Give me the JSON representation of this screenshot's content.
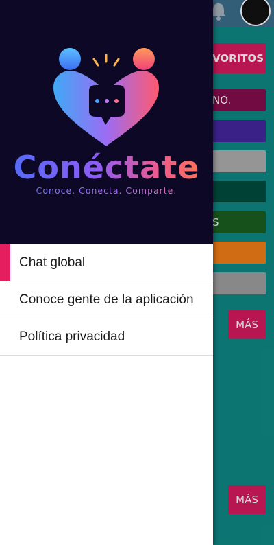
{
  "background": {
    "buttons": [
      {
        "label": "VORITOS",
        "color": "#d81b60"
      },
      {
        "label": "NO.",
        "color": "#880e4f"
      },
      {
        "label": "",
        "color": "#4527a0"
      },
      {
        "label": "",
        "color": "#b0b0b0"
      },
      {
        "label": "",
        "color": "#004d40"
      },
      {
        "label": "S",
        "color": "#1b5e20"
      },
      {
        "label": "",
        "color": "#f57f17"
      },
      {
        "label": "",
        "color": "#a0a0a0"
      }
    ],
    "more_label_1": "MÁS",
    "more_label_2": "MÁS"
  },
  "drawer": {
    "brand": "Conéctate",
    "tagline": "Conoce. Conecta. Comparte.",
    "menu": [
      {
        "label": "Chat global",
        "active": true
      },
      {
        "label": "Conoce gente de la aplicación",
        "active": false
      },
      {
        "label": "Política privacidad",
        "active": false
      }
    ]
  },
  "colors": {
    "accent": "#e51e5f",
    "header_bg": "#0c0826",
    "app_bg": "#0f8a86"
  }
}
